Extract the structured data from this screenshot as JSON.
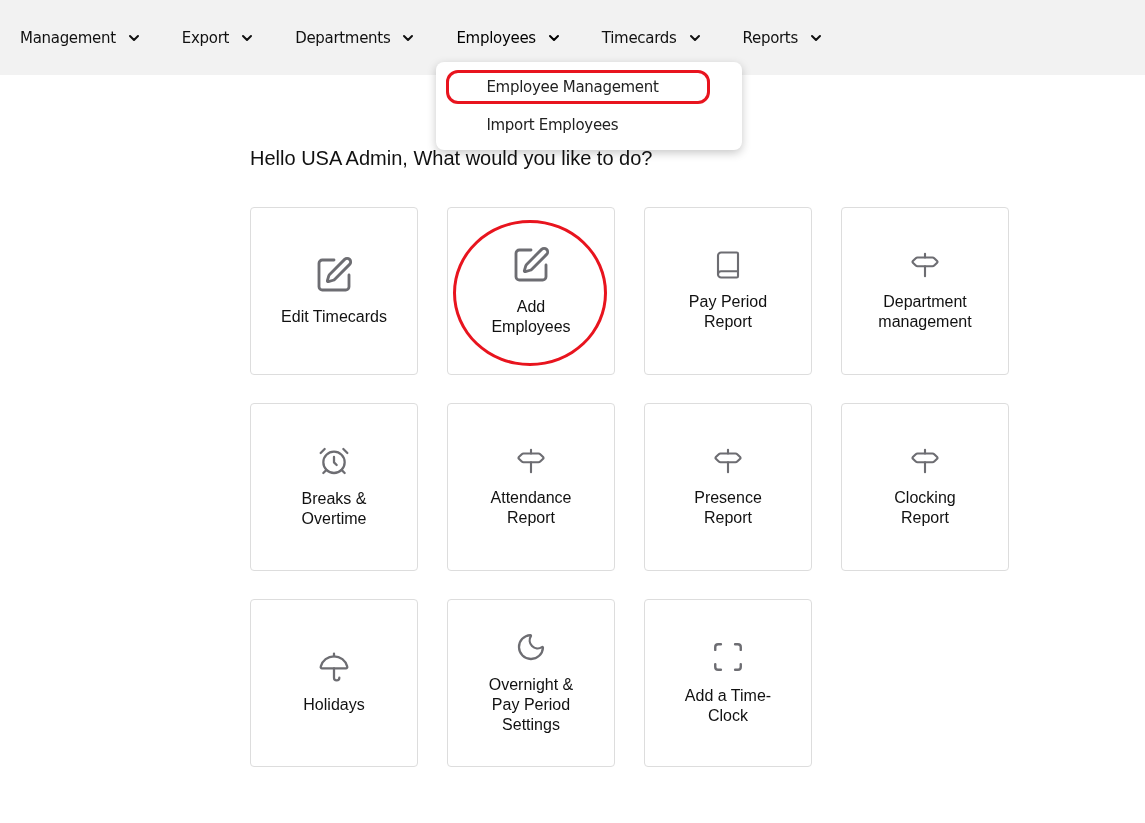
{
  "nav": [
    {
      "label": "Management",
      "expanded": false
    },
    {
      "label": "Export",
      "expanded": false
    },
    {
      "label": "Departments",
      "expanded": false
    },
    {
      "label": "Employees",
      "expanded": true,
      "menu": [
        {
          "label": "Employee Management",
          "highlighted": true
        },
        {
          "label": "Import Employees",
          "highlighted": false
        }
      ]
    },
    {
      "label": "Timecards",
      "expanded": false
    },
    {
      "label": "Reports",
      "expanded": false
    }
  ],
  "greeting": "Hello USA Admin, What would you like to do?",
  "tiles": [
    {
      "label": "Edit Timecards",
      "kind": "edit",
      "highlighted": false
    },
    {
      "label": "Add Employees",
      "kind": "edit",
      "highlighted": true
    },
    {
      "label": "Pay Period Report",
      "kind": "book",
      "highlighted": false
    },
    {
      "label": "Department management",
      "kind": "signpost",
      "highlighted": false
    },
    {
      "label": "Breaks & Overtime",
      "kind": "alarm",
      "highlighted": false
    },
    {
      "label": "Attendance Report",
      "kind": "signpost",
      "highlighted": false
    },
    {
      "label": "Presence Report",
      "kind": "signpost",
      "highlighted": false
    },
    {
      "label": "Clocking Report",
      "kind": "signpost",
      "highlighted": false
    },
    {
      "label": "Holidays",
      "kind": "umbrella",
      "highlighted": false
    },
    {
      "label": "Overnight & Pay Period Settings",
      "kind": "moon",
      "highlighted": false
    },
    {
      "label": "Add a Time-Clock",
      "kind": "scan",
      "highlighted": false
    }
  ]
}
